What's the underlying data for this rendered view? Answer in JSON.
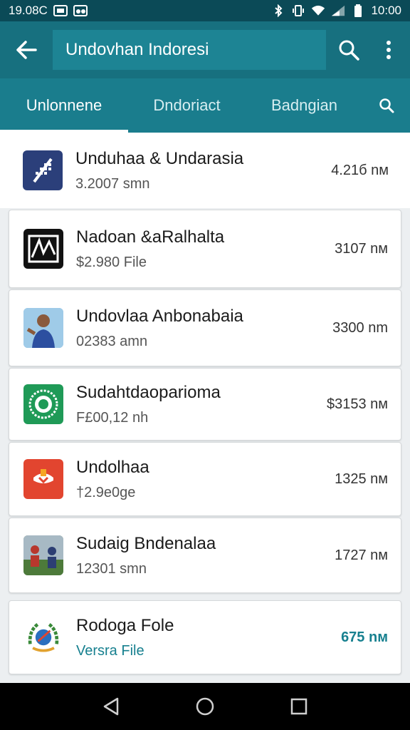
{
  "status_bar": {
    "time_left": "19.08C",
    "time_right": "10:00"
  },
  "app_bar": {
    "search_text": "Undovhan Indoresi"
  },
  "tabs": [
    {
      "label": "Unlonnene",
      "active": true
    },
    {
      "label": "Dndoriact",
      "active": false
    },
    {
      "label": "Badngian",
      "active": false
    }
  ],
  "items": [
    {
      "title": "Unduhaa & Undarasia",
      "subtitle": "3.2007 smn",
      "size": "4.21б nм",
      "icon": "blue-grid-app-icon",
      "accent": false
    },
    {
      "title": "Nadoan &aRalhalta",
      "subtitle": "$2.980 File",
      "size": "3107 nм",
      "icon": "black-screen-app-icon",
      "accent": false
    },
    {
      "title": "Undovlaa Anbonabaia",
      "subtitle": "02383 amn",
      "size": "3300 nm",
      "icon": "person-photo-app-icon",
      "accent": false
    },
    {
      "title": "Sudahtdaoparioma",
      "subtitle": "F£00,12 nh",
      "size": "$3153 nм",
      "icon": "green-seal-app-icon",
      "accent": false
    },
    {
      "title": "Undolhaa",
      "subtitle": "†2.9e0ge",
      "size": "1325 nм",
      "icon": "red-download-app-icon",
      "accent": false
    },
    {
      "title": "Sudaig Bndenalaa",
      "subtitle": "12301 smn",
      "size": "1727 nм",
      "icon": "people-photo-app-icon",
      "accent": false
    },
    {
      "title": "Rodoga Fole",
      "subtitle": "Versra File",
      "size": "675 nм",
      "icon": "laurel-emblem-app-icon",
      "accent": true
    }
  ],
  "colors": {
    "status_bar": "#0b4a57",
    "app_bar": "#17707f",
    "tab_bar": "#1a7d8d",
    "accent": "#17808f"
  }
}
